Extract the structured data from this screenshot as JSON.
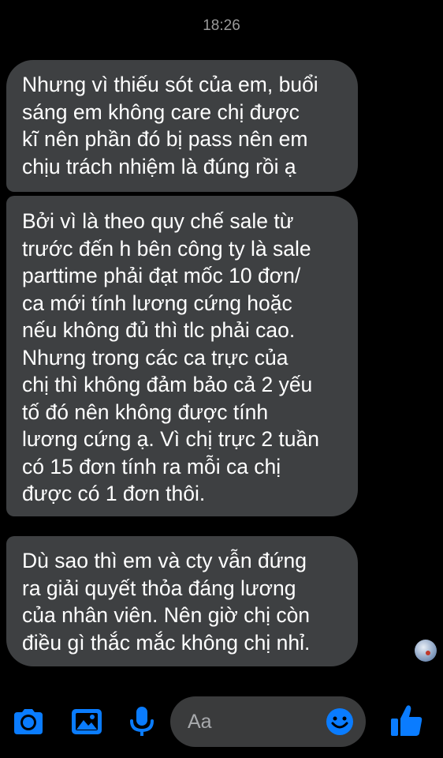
{
  "thread": {
    "timestamp": "18:26"
  },
  "messages": [
    {
      "lines": [
        "Nhưng vì thiếu sót của em, buổi",
        "sáng em không care chị được",
        "kĩ nên phần đó bị pass nên em",
        "chịu trách nhiệm là đúng rồi ạ"
      ]
    },
    {
      "lines": [
        "Bởi vì là theo quy chế sale từ",
        "trước đến h bên công ty là sale",
        "parttime phải đạt mốc 10 đơn/",
        "ca mới tính lương cứng hoặc",
        "nếu không đủ thì tlc phải cao.",
        "Nhưng trong các ca trực của",
        "chị thì không đảm bảo cả 2 yếu",
        "tố đó nên không được tính",
        "lương cứng ạ. Vì chị trực 2 tuần",
        "có 15 đơn tính ra mỗi ca chị",
        "được có 1 đơn thôi."
      ]
    },
    {
      "lines": [
        "Dù sao thì em và cty vẫn đứng",
        "ra giải quyết thỏa đáng lương",
        "của nhân viên. Nên giờ chị còn",
        "điều gì thắc mắc không chị nhỉ."
      ]
    }
  ],
  "composer": {
    "placeholder": "Aa",
    "icons": [
      "camera-icon",
      "image-icon",
      "microphone-icon",
      "emoji-icon",
      "thumbs-up-icon"
    ]
  },
  "colors": {
    "background": "#000000",
    "bubble": "#3e4042",
    "accent": "#0a7cff",
    "input": "#3a3b3c"
  }
}
